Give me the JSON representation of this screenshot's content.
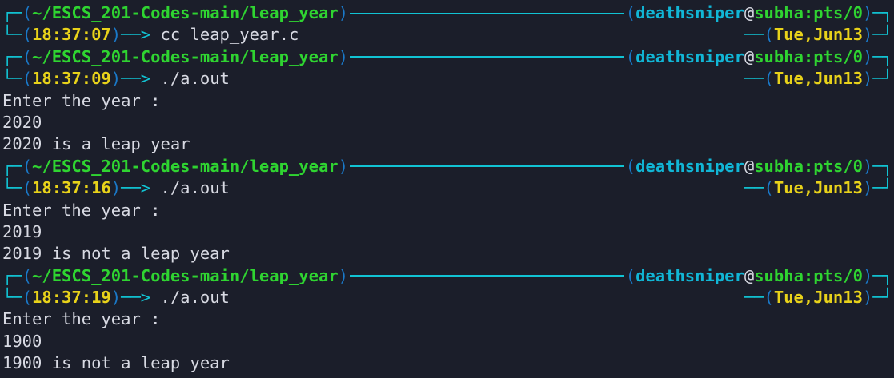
{
  "prompt": {
    "cwd": "~/ESCS_201-Codes-main/leap_year",
    "user": "deathsniper",
    "host_tty": "subha:pts/0",
    "date": "Tue,Jun13",
    "arrow": "──>"
  },
  "blocks": [
    {
      "time": "18:37:07",
      "command": "cc leap_year.c",
      "output": []
    },
    {
      "time": "18:37:09",
      "command": "./a.out",
      "output": [
        "Enter the year :",
        "2020",
        "2020 is a leap year"
      ]
    },
    {
      "time": "18:37:16",
      "command": "./a.out",
      "output": [
        "Enter the year :",
        "2019",
        "2019 is not a leap year"
      ]
    },
    {
      "time": "18:37:19",
      "command": "./a.out",
      "output": [
        "Enter the year :",
        "1900",
        "1900 is not a leap year"
      ]
    }
  ],
  "colors": {
    "background": "#1b1e2a",
    "path": "#2fd431",
    "time": "#e8d21a",
    "user": "#11b6d6",
    "frame": "#11c3d3",
    "text": "#d8dae3"
  }
}
